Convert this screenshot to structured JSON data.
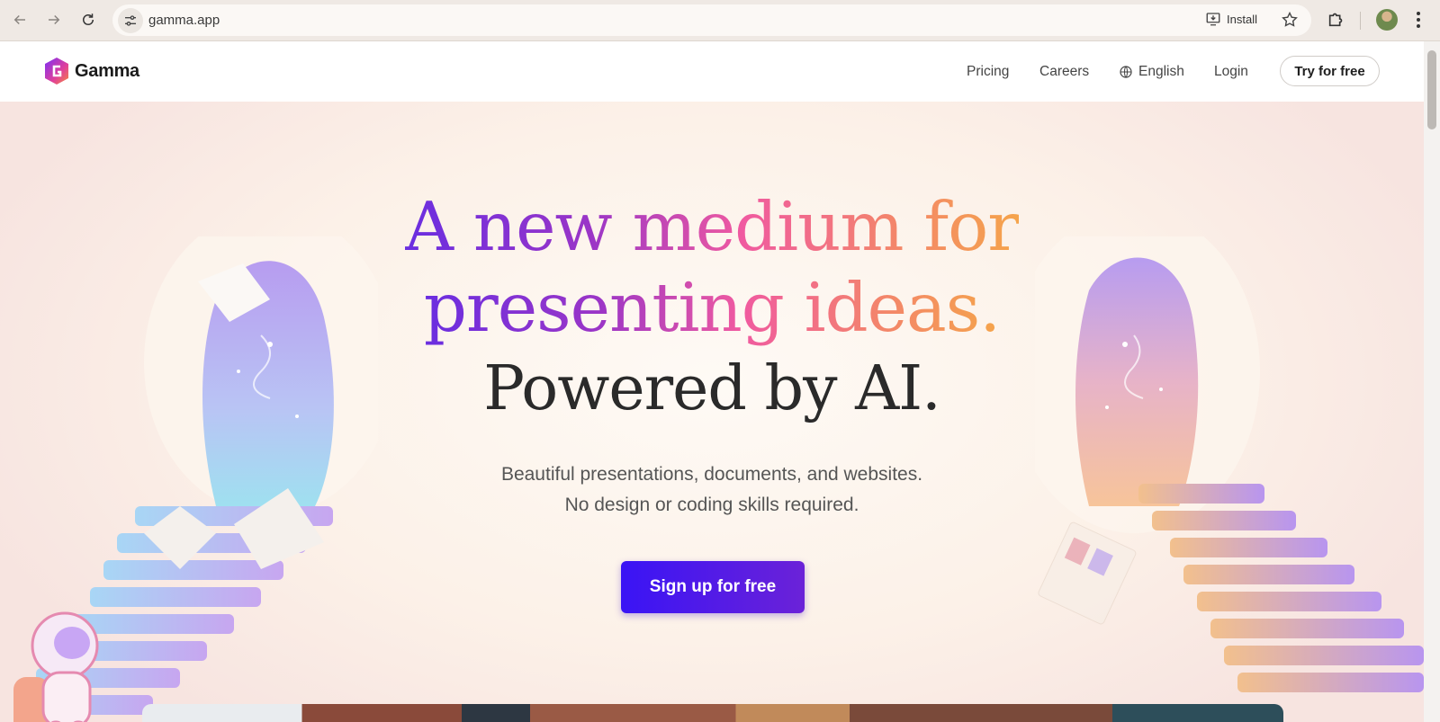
{
  "browser": {
    "url": "gamma.app",
    "install_label": "Install",
    "icons": [
      "back-arrow-icon",
      "forward-arrow-icon",
      "reload-icon",
      "site-info-icon",
      "install-icon",
      "bookmark-star-icon",
      "extensions-puzzle-icon",
      "profile-avatar",
      "more-menu-icon"
    ]
  },
  "header": {
    "brand": "Gamma",
    "nav": {
      "pricing": "Pricing",
      "careers": "Careers",
      "language": "English",
      "login": "Login",
      "try_free": "Try for free"
    }
  },
  "hero": {
    "headline_line1": "A new medium for",
    "headline_line2": "presenting ideas.",
    "powered": "Powered by AI.",
    "sub_line1": "Beautiful presentations, documents, and websites.",
    "sub_line2": "No design or coding skills required.",
    "cta": "Sign up for free"
  },
  "colors": {
    "accent_start": "#3a14f5",
    "accent_end": "#6b22d8",
    "gradient_purple": "#6a2ee0",
    "gradient_pink": "#f05aa0",
    "gradient_orange": "#f5a44b"
  }
}
